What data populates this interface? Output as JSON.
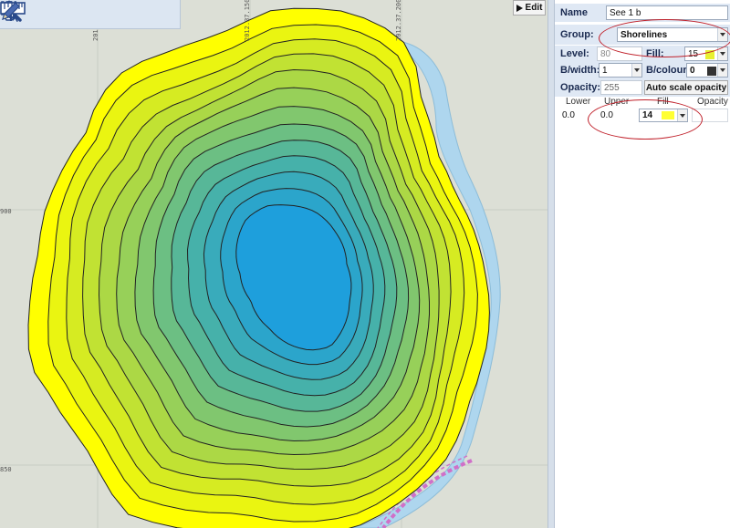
{
  "map": {
    "coordinate_labels": {
      "top_1": "2012.37.100",
      "top_2": "2012.37.150",
      "top_3": "2012.37.200",
      "left_1": "900",
      "left_2": "850"
    },
    "edit_button_label": "Edit",
    "colors": {
      "background": "#dcdfd6",
      "water": "#aed6ee",
      "contour_outer": "#ffff00",
      "contour_inner": "#1e9fdc",
      "contour_line": "#222222",
      "dashed_path": "#d070c8"
    }
  },
  "toolbar": {
    "tools": [
      {
        "icon": "zoom-in-icon"
      },
      {
        "icon": "pan-hand-icon"
      },
      {
        "icon": "select-area-icon"
      },
      {
        "icon": "measure-caduceus-icon"
      },
      {
        "icon": "ruler-icon"
      },
      {
        "icon": "pencil-icon"
      }
    ]
  },
  "panel": {
    "name": {
      "label": "Name",
      "value": "See 1 b"
    },
    "group": {
      "label": "Group:",
      "value": "Shorelines"
    },
    "level": {
      "label": "Level:",
      "value": "80"
    },
    "fill": {
      "label": "Fill:",
      "value": "15",
      "swatch": "#e8f030"
    },
    "bwidth": {
      "label": "B/width:",
      "value": "1"
    },
    "bcolour": {
      "label": "B/colour:",
      "value": "0",
      "swatch": "#333333"
    },
    "opacity": {
      "label": "Opacity:",
      "value": "255"
    },
    "auto_scale_label": "Auto scale opacity",
    "table": {
      "headers": [
        "Lower",
        "Upper",
        "Fill",
        "Opacity"
      ],
      "row": {
        "lower": "0.0",
        "upper": "0.0",
        "fill": "14",
        "fill_swatch": "#ffff33"
      }
    },
    "highlight_color": "#c0202a"
  }
}
